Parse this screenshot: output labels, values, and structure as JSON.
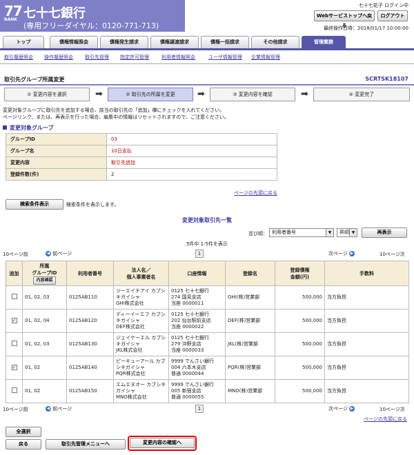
{
  "header": {
    "logo_num": "77",
    "logo_bank": "BANK",
    "bank_name": "七十七銀行",
    "free_dial": "(専用フリーダイヤル：0120-771-713)",
    "user_line": "七十七花子 ログイン中",
    "web_top_btn": "Webサービストップへ戻る",
    "logout_btn": "ログアウト",
    "last_op": "最終操作日時：2018/01/17 10:00:00"
  },
  "tabs": [
    "トップ",
    "債権情報照会",
    "債権発生請求",
    "債権譲渡請求",
    "債権一括請求",
    "その他請求",
    "管理業務"
  ],
  "submenu": [
    "取引履歴照会",
    "操作履歴照会",
    "取引先管理",
    "指定許可管理",
    "利用者情報照会",
    "ユーザ情報管理",
    "企業情報管理"
  ],
  "screen": {
    "title": "取引先グループ所属変更",
    "id": "SCRTSK18107"
  },
  "steps": [
    "① 変更内容を選択",
    "② 取引先の所属を変更",
    "③ 変更内容を確認",
    "④ 変更完了"
  ],
  "desc": [
    "変更対象グループに取引先を追加する場合、該当の取引先の「追加」欄にチェックを入れてください。",
    "ページリンク、または、再表示を行った場合、編集中の情報はリセットされますので、ご注意ください。"
  ],
  "section_title": "変更対象グループ",
  "info": [
    {
      "label": "グループID",
      "value": "03",
      "red": true
    },
    {
      "label": "グループ名",
      "value": "10日支払",
      "red": true
    },
    {
      "label": "変更内容",
      "value": "取引先追加",
      "red": true
    },
    {
      "label": "登録件数(件)",
      "value": "2",
      "red": false
    }
  ],
  "page_top": "ページの先頭に戻る",
  "search_btn": "検索条件表示",
  "search_note": "検索条件を表示します。",
  "list_title": "変更対象取引先一覧",
  "sort": {
    "label": "並び順：",
    "field": "利用者番号",
    "order": "昇順",
    "redisplay": "再表示"
  },
  "paging": {
    "count": "5件中 1-5件を表示",
    "prev10": "10ページ前",
    "prev": "前ページ",
    "page": "1",
    "next": "次ページ",
    "next10": "10ページ次"
  },
  "columns": {
    "add": "追加",
    "group_id_1": "所属",
    "group_id_2": "グループID",
    "detail_btn": "内容確認",
    "user_no": "利用者番号",
    "name_1": "法人名／",
    "name_2": "個人事業者名",
    "account": "口座情報",
    "reg_name": "登録名",
    "amount_1": "登録債権",
    "amount_2": "金額(円)",
    "fee": "手数料"
  },
  "rows": [
    {
      "checked": false,
      "groups": "01, 02, 03",
      "user_no": "0125AB110",
      "kana": "ジーエイチアイ カブシキガイシャ",
      "name": "GHI株式会社",
      "acc1": "0125 七十七銀行",
      "acc2": "274 国見支店",
      "acc3": "当座 0000011",
      "reg": "GHI(株)営業部",
      "amount": "500,000",
      "fee": "当方負担"
    },
    {
      "checked": true,
      "groups": "01, 02, 04",
      "user_no": "0125AB120",
      "kana": "ディーイーエフ カブシキガイシャ",
      "name": "DEF株式会社",
      "acc1": "0125 七十七銀行",
      "acc2": "202 仙台駅前支店",
      "acc3": "当座 0000022",
      "reg": "DEF(株)営業部",
      "amount": "500,000",
      "fee": "当方負担"
    },
    {
      "checked": false,
      "groups": "01, 02, 03",
      "user_no": "0125AB130",
      "kana": "ジェイケーエル カブシキガイシャ",
      "name": "JKL株式会社",
      "acc1": "0125 七十七銀行",
      "acc2": "279 沖野支店",
      "acc3": "当座 0000033",
      "reg": "JKL(株)営業部",
      "amount": "500,000",
      "fee": "当方負担"
    },
    {
      "checked": true,
      "groups": "01, 02",
      "user_no": "0125AB140",
      "kana": "ピーキューアール カブシキガイシャ",
      "name": "PQR株式会社",
      "acc1": "9999 でんさい銀行",
      "acc2": "004 六本木支店",
      "acc3": "普通 0000044",
      "reg": "PQR(株)営業部",
      "amount": "500,000",
      "fee": "当方負担"
    },
    {
      "checked": false,
      "groups": "01, 02",
      "user_no": "0125AB150",
      "kana": "エムエヌオー カブシキガイシャ",
      "name": "MNO株式会社",
      "acc1": "9999 でんさい銀行",
      "acc2": "005 新宿支店",
      "acc3": "普通 0000055",
      "reg": "MNO(株)営業部",
      "amount": "500,000",
      "fee": "当方負担"
    }
  ],
  "footer": {
    "select_all": "全選択",
    "back": "戻る",
    "menu": "取引先管理メニューへ",
    "confirm": "変更内容の確認へ"
  },
  "colors": {
    "brand": "#7e7fc6",
    "tab_active": "#5556a7",
    "label_bg": "#f6edd6",
    "highlight": "#e00000"
  }
}
